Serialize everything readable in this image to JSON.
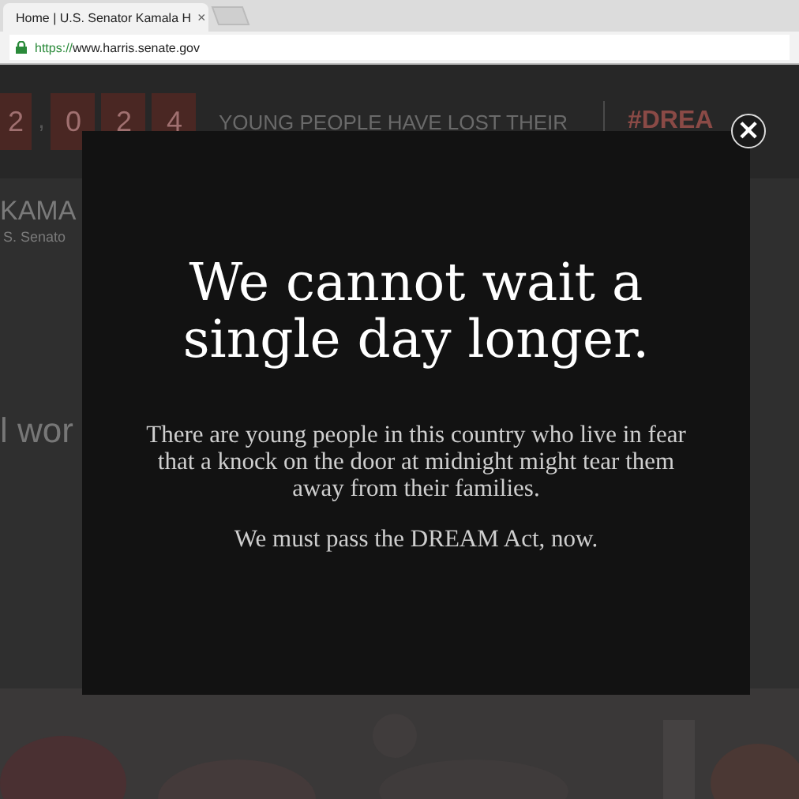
{
  "browser": {
    "tab": {
      "title": "Home | U.S. Senator Kamala H",
      "close": "×"
    },
    "address": {
      "scheme": "https://",
      "host": "www.harris.senate.gov",
      "secure": true
    }
  },
  "page": {
    "counter": {
      "digits": [
        "2",
        "0",
        "2",
        "4"
      ],
      "separator": ","
    },
    "counter_caption": "YOUNG PEOPLE HAVE LOST THEIR",
    "hashtag": "#DREA",
    "name_heading": "KAMA",
    "subtitle": "S. Senato",
    "body_fragment": "l wor"
  },
  "modal": {
    "close": "×",
    "heading": "We cannot wait a single day longer.",
    "paragraphs": [
      "There are young people in this country who live in fear that a knock on the door at midnight might tear them away from their families.",
      "We must pass the DREAM Act, now."
    ]
  }
}
